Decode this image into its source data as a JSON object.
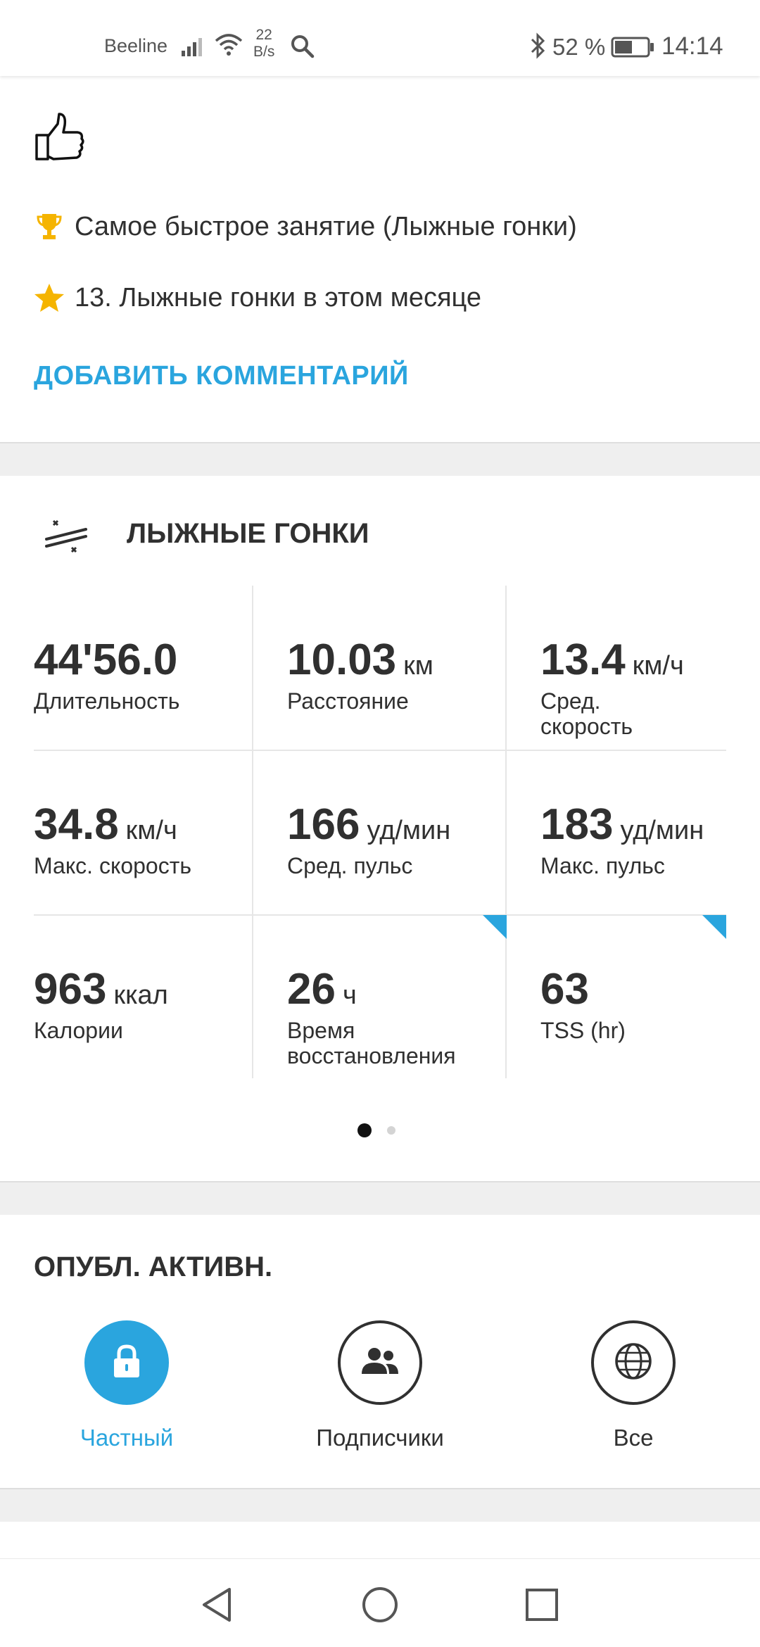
{
  "status_bar": {
    "carrier": "Beeline",
    "net_speed_value": "22",
    "net_speed_unit": "B/s",
    "battery_percent": "52 %",
    "time": "14:14"
  },
  "achievements": {
    "items": [
      {
        "icon": "trophy-icon",
        "text": "Самое быстрое занятие (Лыжные гонки)",
        "color": "#f5b400"
      },
      {
        "icon": "star-icon",
        "text": "13. Лыжные гонки в этом месяце",
        "color": "#f5b400"
      }
    ],
    "add_comment_label": "ДОБАВИТЬ КОММЕНТАРИЙ"
  },
  "summary": {
    "sport_title": "ЛЫЖНЫЕ ГОНКИ",
    "stats": [
      {
        "value": "44'56.0",
        "unit": "",
        "label": "Длительность"
      },
      {
        "value": "10.03",
        "unit": "км",
        "label": "Расстояние"
      },
      {
        "value": "13.4",
        "unit": "км/ч",
        "label": "Сред. скорость"
      },
      {
        "value": "34.8",
        "unit": "км/ч",
        "label": "Макс. скорость"
      },
      {
        "value": "166",
        "unit": "уд/мин",
        "label": "Сред. пульс"
      },
      {
        "value": "183",
        "unit": "уд/мин",
        "label": "Макс. пульс"
      },
      {
        "value": "963",
        "unit": "ккал",
        "label": "Калории"
      },
      {
        "value": "26",
        "unit": "ч",
        "label": "Время восстановления"
      },
      {
        "value": "63",
        "unit": "",
        "label": "TSS (hr)"
      }
    ],
    "page_indicator": {
      "current": 1,
      "total": 2
    }
  },
  "publish": {
    "title": "ОПУБЛ. АКТИВН.",
    "options": [
      {
        "label": "Частный",
        "icon": "lock-icon",
        "selected": true
      },
      {
        "label": "Подписчики",
        "icon": "people-icon",
        "selected": false
      },
      {
        "label": "Все",
        "icon": "globe-icon",
        "selected": false
      }
    ]
  },
  "colors": {
    "accent": "#2aa5de",
    "text": "#303030",
    "separator": "#efefef",
    "award": "#f5b400"
  }
}
